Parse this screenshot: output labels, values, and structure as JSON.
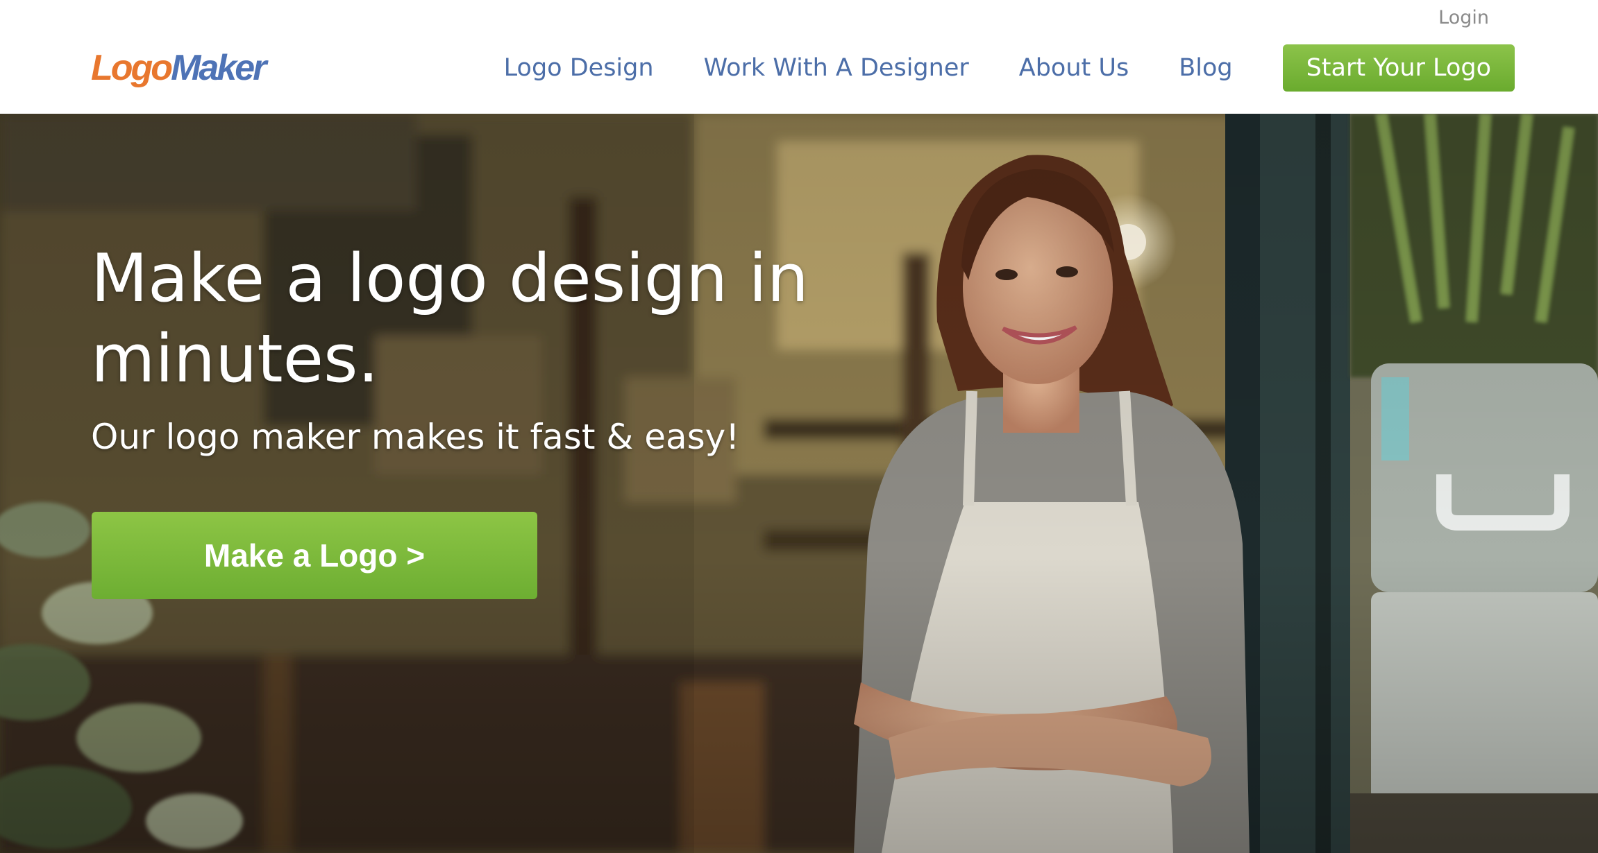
{
  "header": {
    "logo": {
      "part1": "Logo",
      "part2": "Maker"
    },
    "login_label": "Login",
    "nav": {
      "logo_design": "Logo Design",
      "work_with_designer": "Work With A Designer",
      "about_us": "About Us",
      "blog": "Blog",
      "start_your_logo": "Start Your Logo"
    }
  },
  "hero": {
    "title": "Make a logo design in minutes.",
    "subtitle": "Our logo maker makes it fast & easy!",
    "cta_label": "Make a Logo >",
    "image": "photo-woman-in-apron-smiling-at-cafe-door"
  },
  "colors": {
    "logo_orange": "#e8772e",
    "logo_blue": "#4e73b6",
    "nav_link": "#4c6ea8",
    "cta_green": "#7ab83b"
  }
}
